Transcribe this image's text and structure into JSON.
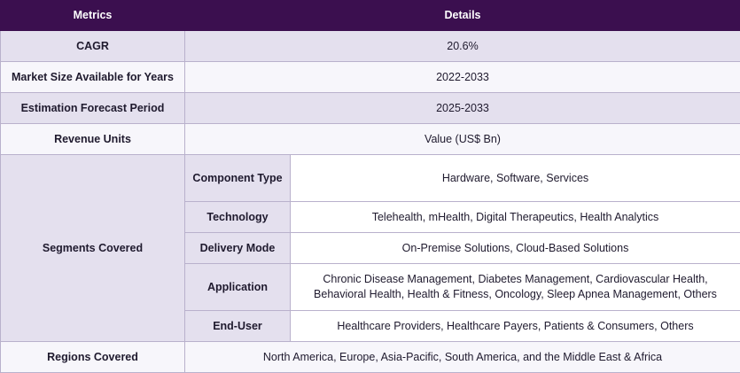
{
  "headers": {
    "metrics": "Metrics",
    "details": "Details"
  },
  "rows": [
    {
      "metric": "CAGR",
      "value": "20.6%"
    },
    {
      "metric": "Market Size Available for Years",
      "value": "2022-2033"
    },
    {
      "metric": "Estimation Forecast Period",
      "value": "2025-2033"
    },
    {
      "metric": "Revenue Units",
      "value": "Value (US$ Bn)"
    }
  ],
  "segments": {
    "label": "Segments Covered",
    "items": [
      {
        "name": "Component Type",
        "value": "Hardware, Software, Services"
      },
      {
        "name": "Technology",
        "value": "Telehealth, mHealth, Digital Therapeutics, Health Analytics"
      },
      {
        "name": "Delivery Mode",
        "value": "On-Premise Solutions, Cloud-Based Solutions"
      },
      {
        "name": "Application",
        "value": "Chronic Disease Management, Diabetes Management, Cardiovascular Health, Behavioral Health, Health & Fitness, Oncology, Sleep Apnea Management, Others"
      },
      {
        "name": "End-User",
        "value": "Healthcare Providers, Healthcare Payers, Patients & Consumers, Others"
      }
    ]
  },
  "regions": {
    "label": "Regions Covered",
    "value": "North America, Europe, Asia-Pacific, South America, and the Middle East & Africa"
  }
}
